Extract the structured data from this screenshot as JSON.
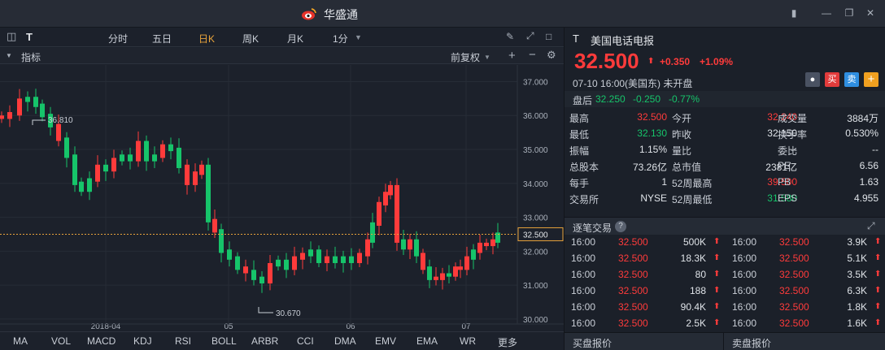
{
  "window": {
    "title": "华盛通"
  },
  "toolbar": {
    "symbol": "T",
    "tabs": [
      "分时",
      "五日",
      "日K",
      "周K",
      "月K",
      "1分"
    ],
    "active_tab": "日K"
  },
  "subbar": {
    "indicator_label": "指标",
    "adjust_label": "前复权"
  },
  "chart_data": {
    "type": "candlestick",
    "y_ticks": [
      "37.000",
      "36.000",
      "35.000",
      "34.000",
      "33.000",
      "32.000",
      "31.000",
      "30.000"
    ],
    "ylim": [
      29.95,
      37.25
    ],
    "x_ticks": [
      "2018-04",
      "05",
      "06",
      "07"
    ],
    "high_label": "36.810",
    "low_label": "30.670",
    "last_price_label": "32.500",
    "last_price": 32.5,
    "up_color": "#ff3b3b",
    "down_color": "#16c46a"
  },
  "indicators": [
    "MA",
    "VOL",
    "MACD",
    "KDJ",
    "RSI",
    "BOLL",
    "ARBR",
    "CCI",
    "DMA",
    "EMV",
    "EMA",
    "WR",
    "更多"
  ],
  "quote": {
    "ticker": "T",
    "name": "美国电话电报",
    "price": "32.500",
    "change": "+0.350",
    "change_pct": "+1.09%",
    "status": "07-10  16:00(美国东)  未开盘",
    "buy_label": "买",
    "sell_label": "卖",
    "add_label": "+",
    "after_label": "盘后",
    "after_price": "32.250",
    "after_change": "-0.250",
    "after_pct": "-0.77%"
  },
  "stats": [
    [
      {
        "k": "最高",
        "v": "32.500",
        "c": "up"
      },
      {
        "k": "今开",
        "v": "32.240",
        "c": "up"
      },
      {
        "k": "成交量",
        "v": "3884万",
        "c": ""
      }
    ],
    [
      {
        "k": "最低",
        "v": "32.130",
        "c": "dn"
      },
      {
        "k": "昨收",
        "v": "32.150",
        "c": ""
      },
      {
        "k": "换手率",
        "v": "0.530%",
        "c": ""
      }
    ],
    [
      {
        "k": "振幅",
        "v": "1.15%",
        "c": ""
      },
      {
        "k": "量比",
        "v": "--",
        "c": ""
      },
      {
        "k": "委比",
        "v": "--",
        "c": ""
      }
    ],
    [
      {
        "k": "总股本",
        "v": "73.26亿",
        "c": ""
      },
      {
        "k": "总市值",
        "v": "2381亿",
        "c": ""
      },
      {
        "k": "PE",
        "v": "6.56",
        "c": ""
      }
    ],
    [
      {
        "k": "每手",
        "v": "1",
        "c": ""
      },
      {
        "k": "52周最高",
        "v": "39.500",
        "c": "up"
      },
      {
        "k": "PB",
        "v": "1.63",
        "c": ""
      }
    ],
    [
      {
        "k": "交易所",
        "v": "NYSE",
        "c": ""
      },
      {
        "k": "52周最低",
        "v": "31.580",
        "c": "dn"
      },
      {
        "k": "EPS",
        "v": "4.955",
        "c": ""
      }
    ]
  ],
  "trades": {
    "title": "逐笔交易",
    "left": [
      [
        "16:00",
        "32.500",
        "500K"
      ],
      [
        "16:00",
        "32.500",
        "18.3K"
      ],
      [
        "16:00",
        "32.500",
        "80"
      ],
      [
        "16:00",
        "32.500",
        "188"
      ],
      [
        "16:00",
        "32.500",
        "90.4K"
      ],
      [
        "16:00",
        "32.500",
        "2.5K"
      ]
    ],
    "right": [
      [
        "16:00",
        "32.500",
        "3.9K"
      ],
      [
        "16:00",
        "32.500",
        "5.1K"
      ],
      [
        "16:00",
        "32.500",
        "3.5K"
      ],
      [
        "16:00",
        "32.500",
        "6.3K"
      ],
      [
        "16:00",
        "32.500",
        "1.8K"
      ],
      [
        "16:00",
        "32.500",
        "1.6K"
      ]
    ]
  },
  "orderbook": {
    "buy_label": "买盘报价",
    "sell_label": "卖盘报价"
  }
}
